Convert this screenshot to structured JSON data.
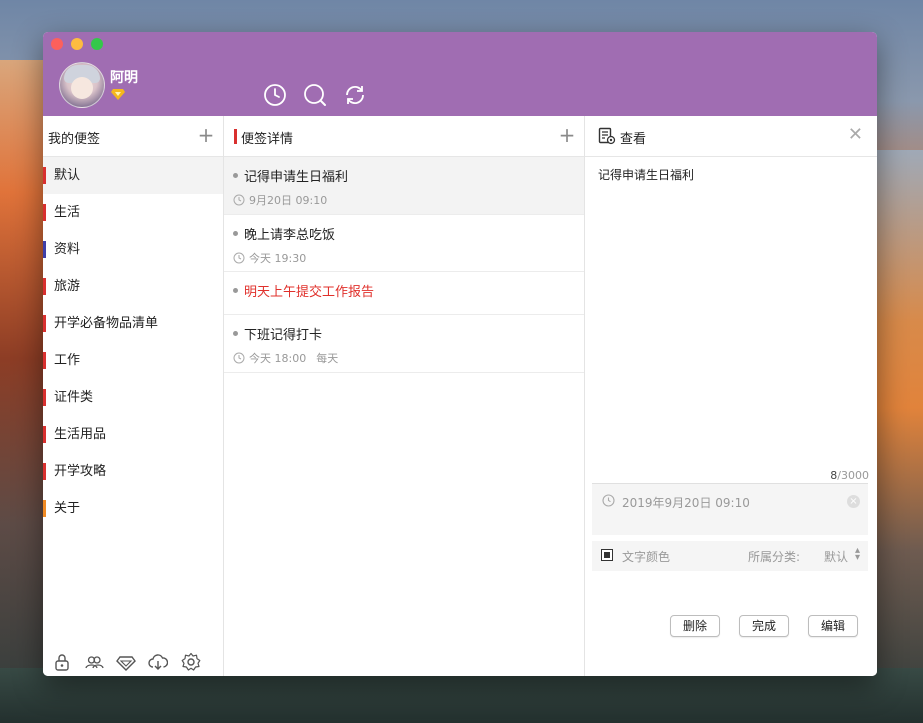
{
  "user": {
    "name": "阿明"
  },
  "left": {
    "title": "我的便签",
    "categories": [
      {
        "label": "默认",
        "color": "#d9302f"
      },
      {
        "label": "生活",
        "color": "#d9302f"
      },
      {
        "label": "资料",
        "color": "#3f3fa8"
      },
      {
        "label": "旅游",
        "color": "#d9302f"
      },
      {
        "label": "开学必备物品清单",
        "color": "#d9302f"
      },
      {
        "label": "工作",
        "color": "#d9302f"
      },
      {
        "label": "证件类",
        "color": "#d9302f"
      },
      {
        "label": "生活用品",
        "color": "#d9302f"
      },
      {
        "label": "开学攻略",
        "color": "#d9302f"
      },
      {
        "label": "关于",
        "color": "#f08a24"
      }
    ],
    "footer_icons": [
      "lock-icon",
      "group-icon",
      "diamond-icon",
      "cloud-download-icon",
      "settings-icon"
    ]
  },
  "middle": {
    "title": "便签详情",
    "notes": [
      {
        "title": "记得申请生日福利",
        "time": "9月20日 09:10",
        "repeat": ""
      },
      {
        "title": "晚上请李总吃饭",
        "time": "今天 19:30",
        "repeat": ""
      },
      {
        "title": "明天上午提交工作报告",
        "time": "",
        "repeat": ""
      },
      {
        "title": "下班记得打卡",
        "time": "今天 18:00",
        "repeat": "每天"
      }
    ]
  },
  "right": {
    "title": "查看",
    "content": "记得申请生日福利",
    "counter": {
      "current": "8",
      "max": "/3000"
    },
    "reminder": "2019年9月20日 09:10",
    "text_color_label": "文字颜色",
    "category_label": "所属分类:",
    "category_value": "默认",
    "buttons": {
      "delete": "删除",
      "done": "完成",
      "edit": "编辑"
    }
  },
  "colors": {
    "header": "#a06db2",
    "accent_red": "#d9302f"
  }
}
